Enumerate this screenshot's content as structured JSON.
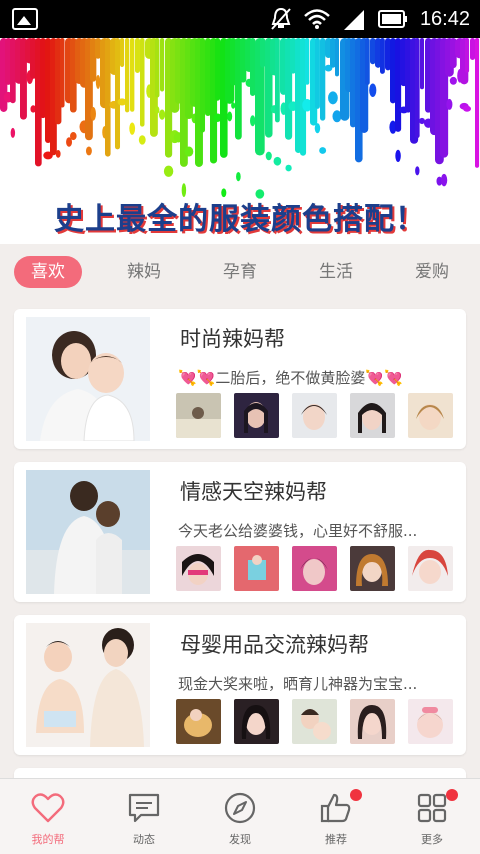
{
  "status": {
    "time": "16:42"
  },
  "banner": {
    "title": "史上最全的服装颜色搭配！"
  },
  "tabs": [
    {
      "label": "喜欢",
      "active": true
    },
    {
      "label": "辣妈",
      "active": false
    },
    {
      "label": "孕育",
      "active": false
    },
    {
      "label": "生活",
      "active": false
    },
    {
      "label": "爱购",
      "active": false
    }
  ],
  "groups": [
    {
      "title": "时尚辣妈帮",
      "desc": "💘💘二胎后，绝不做黄脸婆💘💘"
    },
    {
      "title": "情感天空辣妈帮",
      "desc": "今天老公给婆婆钱，心里好不舒服..."
    },
    {
      "title": "母婴用品交流辣妈帮",
      "desc": "现金大奖来啦，晒育儿神器为宝宝..."
    }
  ],
  "bottom_nav": [
    {
      "label": "我的帮",
      "icon": "heart-icon",
      "active": true,
      "badge": false
    },
    {
      "label": "动态",
      "icon": "message-icon",
      "active": false,
      "badge": false
    },
    {
      "label": "发现",
      "icon": "compass-icon",
      "active": false,
      "badge": false
    },
    {
      "label": "推荐",
      "icon": "thumbs-up-icon",
      "active": false,
      "badge": true
    },
    {
      "label": "更多",
      "icon": "grid-icon",
      "active": false,
      "badge": true
    }
  ],
  "colors": {
    "accent": "#f36b7b",
    "badge": "#f0333f",
    "status_bar": "#000000"
  }
}
